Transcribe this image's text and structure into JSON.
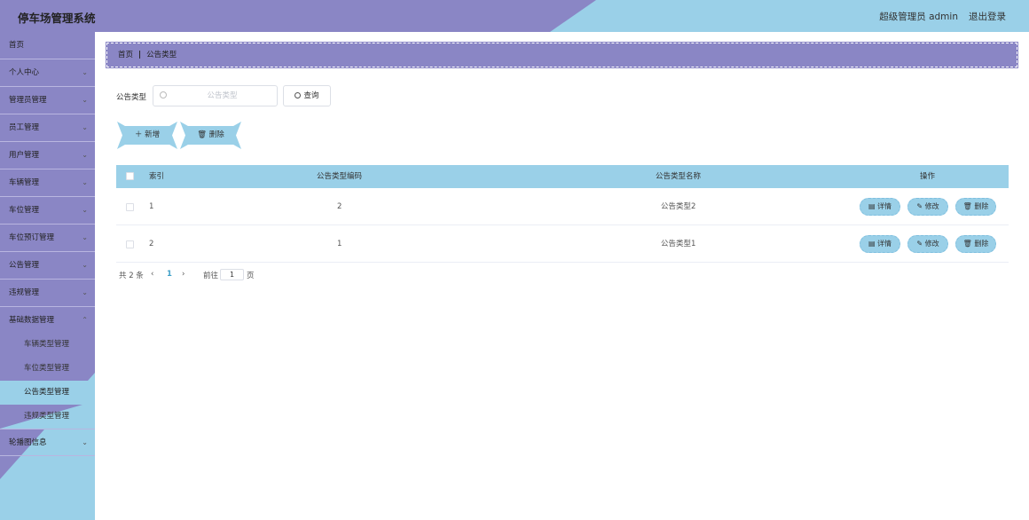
{
  "header": {
    "title": "停车场管理系统",
    "user": "超级管理员 admin",
    "logout": "退出登录"
  },
  "sidebar": {
    "items": [
      {
        "label": "首页",
        "expandable": false
      },
      {
        "label": "个人中心",
        "expandable": true
      },
      {
        "label": "管理员管理",
        "expandable": true
      },
      {
        "label": "员工管理",
        "expandable": true
      },
      {
        "label": "用户管理",
        "expandable": true
      },
      {
        "label": "车辆管理",
        "expandable": true
      },
      {
        "label": "车位管理",
        "expandable": true
      },
      {
        "label": "车位预订管理",
        "expandable": true
      },
      {
        "label": "公告管理",
        "expandable": true
      },
      {
        "label": "违规管理",
        "expandable": true
      },
      {
        "label": "基础数据管理",
        "expandable": true,
        "expanded": true
      },
      {
        "label": "轮播图信息",
        "expandable": true
      }
    ],
    "sub_items": [
      {
        "label": "车辆类型管理"
      },
      {
        "label": "车位类型管理"
      },
      {
        "label": "公告类型管理",
        "active": true
      },
      {
        "label": "违规类型管理"
      }
    ]
  },
  "breadcrumb": {
    "home": "首页",
    "separator": "|",
    "current": "公告类型"
  },
  "search": {
    "label": "公告类型",
    "placeholder": "公告类型",
    "value": "",
    "query_button": "查询"
  },
  "actions": {
    "add": "新增",
    "delete": "删除"
  },
  "table": {
    "headers": [
      "索引",
      "公告类型编码",
      "公告类型名称",
      "操作"
    ],
    "rows": [
      {
        "index": "1",
        "code": "2",
        "name": "公告类型2"
      },
      {
        "index": "2",
        "code": "1",
        "name": "公告类型1"
      }
    ],
    "row_actions": {
      "detail": "详情",
      "edit": "修改",
      "delete": "删除"
    }
  },
  "pagination": {
    "total": "共 2 条",
    "prev": "‹",
    "current_page": "1",
    "next": "›",
    "goto_label": "前往",
    "goto_value": "1",
    "page_suffix": "页"
  },
  "colors": {
    "purple": "#8a86c5",
    "blue": "#9ad0e8"
  }
}
